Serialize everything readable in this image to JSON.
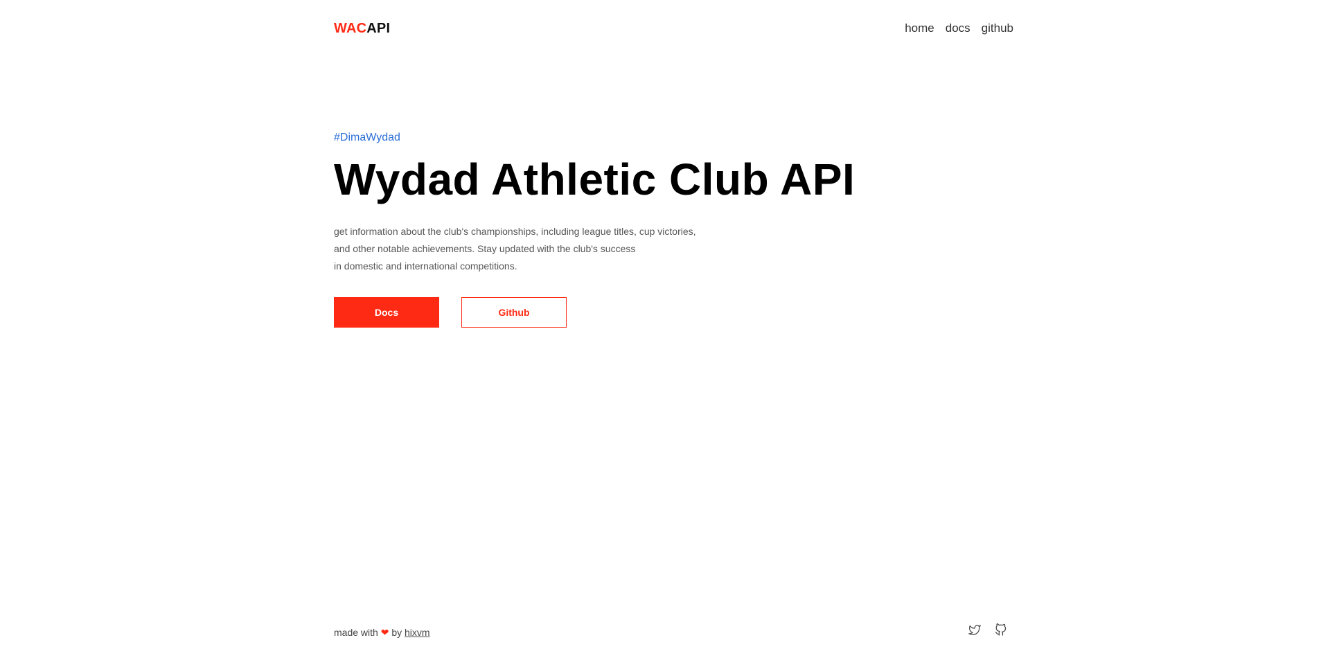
{
  "header": {
    "logo_accent": "WAC",
    "logo_rest": "API",
    "nav": [
      {
        "label": "home"
      },
      {
        "label": "docs"
      },
      {
        "label": "github"
      }
    ]
  },
  "hero": {
    "tag": "#DimaWydad",
    "title": "Wydad Athletic Club API",
    "description_lines": [
      "get information about the club's championships, including league titles, cup victories,",
      "and other notable achievements. Stay updated with the club's success",
      "in domestic and international competitions."
    ],
    "primary_button": "Docs",
    "secondary_button": "Github"
  },
  "footer": {
    "made_with": "made with",
    "by": "by",
    "author": "hixvm",
    "icons": [
      "twitter-icon",
      "github-icon"
    ]
  },
  "colors": {
    "accent": "#ff2a14",
    "tag": "#2b6fd6"
  }
}
